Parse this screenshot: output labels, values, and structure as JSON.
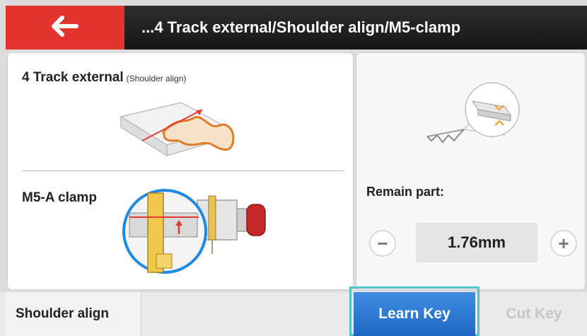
{
  "header": {
    "title": "...4 Track external/Shoulder align/M5-clamp",
    "back_icon": "arrow-left-icon"
  },
  "left_panel": {
    "track_title": "4 Track external",
    "track_subtitle": "(Shoulder align)",
    "clamp_title": "M5-A clamp"
  },
  "right_panel": {
    "remain_label": "Remain part:",
    "value": "1.76mm",
    "minus_symbol": "−",
    "plus_symbol": "+"
  },
  "bottom": {
    "shoulder_tab": "Shoulder align",
    "learn_key": "Learn Key",
    "cut_key": "Cut Key"
  },
  "colors": {
    "back_button": "#e3342f",
    "title_bar": "#1a1a1a",
    "learn_key": "#2a78d4",
    "highlight_outline": "#4fc3c8",
    "cut_key_disabled": "#c6c6c6"
  }
}
